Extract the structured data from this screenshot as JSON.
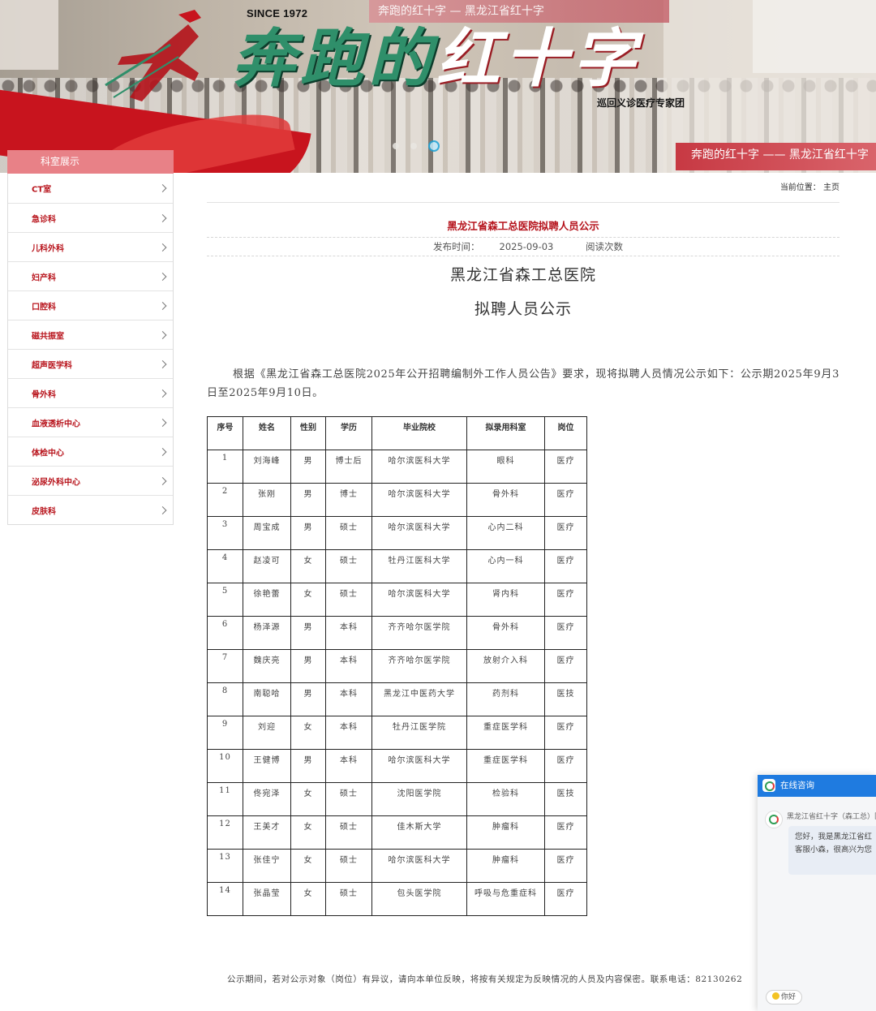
{
  "banner": {
    "since": "SINCE 1972",
    "title_part1": "奔跑的",
    "title_part2": "红十字",
    "subtitle": "巡回义诊医疗专家团",
    "top_band_text": "奔跑的红十字 — 黑龙江省红十字",
    "bottom_text": "奔跑的红十字 —— 黑龙江省红十字",
    "slide_count": 3,
    "active_slide": 3
  },
  "sidebar": {
    "title": "科室展示",
    "items": [
      "CT室",
      "急诊科",
      "儿科外科",
      "妇产科",
      "口腔科",
      "磁共振室",
      "超声医学科",
      "骨外科",
      "血液透析中心",
      "体检中心",
      "泌尿外科中心",
      "皮肤科"
    ]
  },
  "breadcrumb": {
    "prefix": "当前位置：",
    "home": "主页"
  },
  "article": {
    "title": "黑龙江省森工总医院拟聘人员公示",
    "publish_label": "发布时间：",
    "publish_date": "2025-09-03",
    "read_label": "阅读次数",
    "heading1": "黑龙江省森工总医院",
    "heading2": "拟聘人员公示",
    "intro": "根据《黑龙江省森工总医院2025年公开招聘编制外工作人员公告》要求，现将拟聘人员情况公示如下：公示期2025年9月3日至2025年9月10日。",
    "footnote": "公示期间，若对公示对象（岗位）有异议，请向本单位反映，将按有关规定为反映情况的人员及内容保密。联系电话：82130262"
  },
  "table": {
    "headers": [
      "序号",
      "姓名",
      "性别",
      "学历",
      "毕业院校",
      "拟录用科室",
      "岗位"
    ],
    "rows": [
      [
        "1",
        "刘海峰",
        "男",
        "博士后",
        "哈尔滨医科大学",
        "眼科",
        "医疗"
      ],
      [
        "2",
        "张刚",
        "男",
        "博士",
        "哈尔滨医科大学",
        "骨外科",
        "医疗"
      ],
      [
        "3",
        "周宝成",
        "男",
        "硕士",
        "哈尔滨医科大学",
        "心内二科",
        "医疗"
      ],
      [
        "4",
        "赵凌可",
        "女",
        "硕士",
        "牡丹江医科大学",
        "心内一科",
        "医疗"
      ],
      [
        "5",
        "徐艳蕾",
        "女",
        "硕士",
        "哈尔滨医科大学",
        "肾内科",
        "医疗"
      ],
      [
        "6",
        "杨泽源",
        "男",
        "本科",
        "齐齐哈尔医学院",
        "骨外科",
        "医疗"
      ],
      [
        "7",
        "魏庆亮",
        "男",
        "本科",
        "齐齐哈尔医学院",
        "放射介入科",
        "医疗"
      ],
      [
        "8",
        "南聪哈",
        "男",
        "本科",
        "黑龙江中医药大学",
        "药剂科",
        "医技"
      ],
      [
        "9",
        "刘迎",
        "女",
        "本科",
        "牡丹江医学院",
        "重症医学科",
        "医疗"
      ],
      [
        "10",
        "王健博",
        "男",
        "本科",
        "哈尔滨医科大学",
        "重症医学科",
        "医疗"
      ],
      [
        "11",
        "佟宛泽",
        "女",
        "硕士",
        "沈阳医学院",
        "检验科",
        "医技"
      ],
      [
        "12",
        "王美才",
        "女",
        "硕士",
        "佳木斯大学",
        "肿瘤科",
        "医疗"
      ],
      [
        "13",
        "张佳宁",
        "女",
        "硕士",
        "哈尔滨医科大学",
        "肿瘤科",
        "医疗"
      ],
      [
        "14",
        "张晶莹",
        "女",
        "硕士",
        "包头医学院",
        "呼吸与危重症科",
        "医疗"
      ]
    ]
  },
  "chat": {
    "header": "在线咨询",
    "sender": "黑龙江省红十字（森工总）医",
    "message_line1": "您好，我是黑龙江省红",
    "message_line2": "客服小森，很高兴为您",
    "quick_reply": "你好"
  },
  "colors": {
    "accent_red": "#b5121b",
    "sidebar_header": "#e88187",
    "chat_blue": "#1f7be0"
  }
}
